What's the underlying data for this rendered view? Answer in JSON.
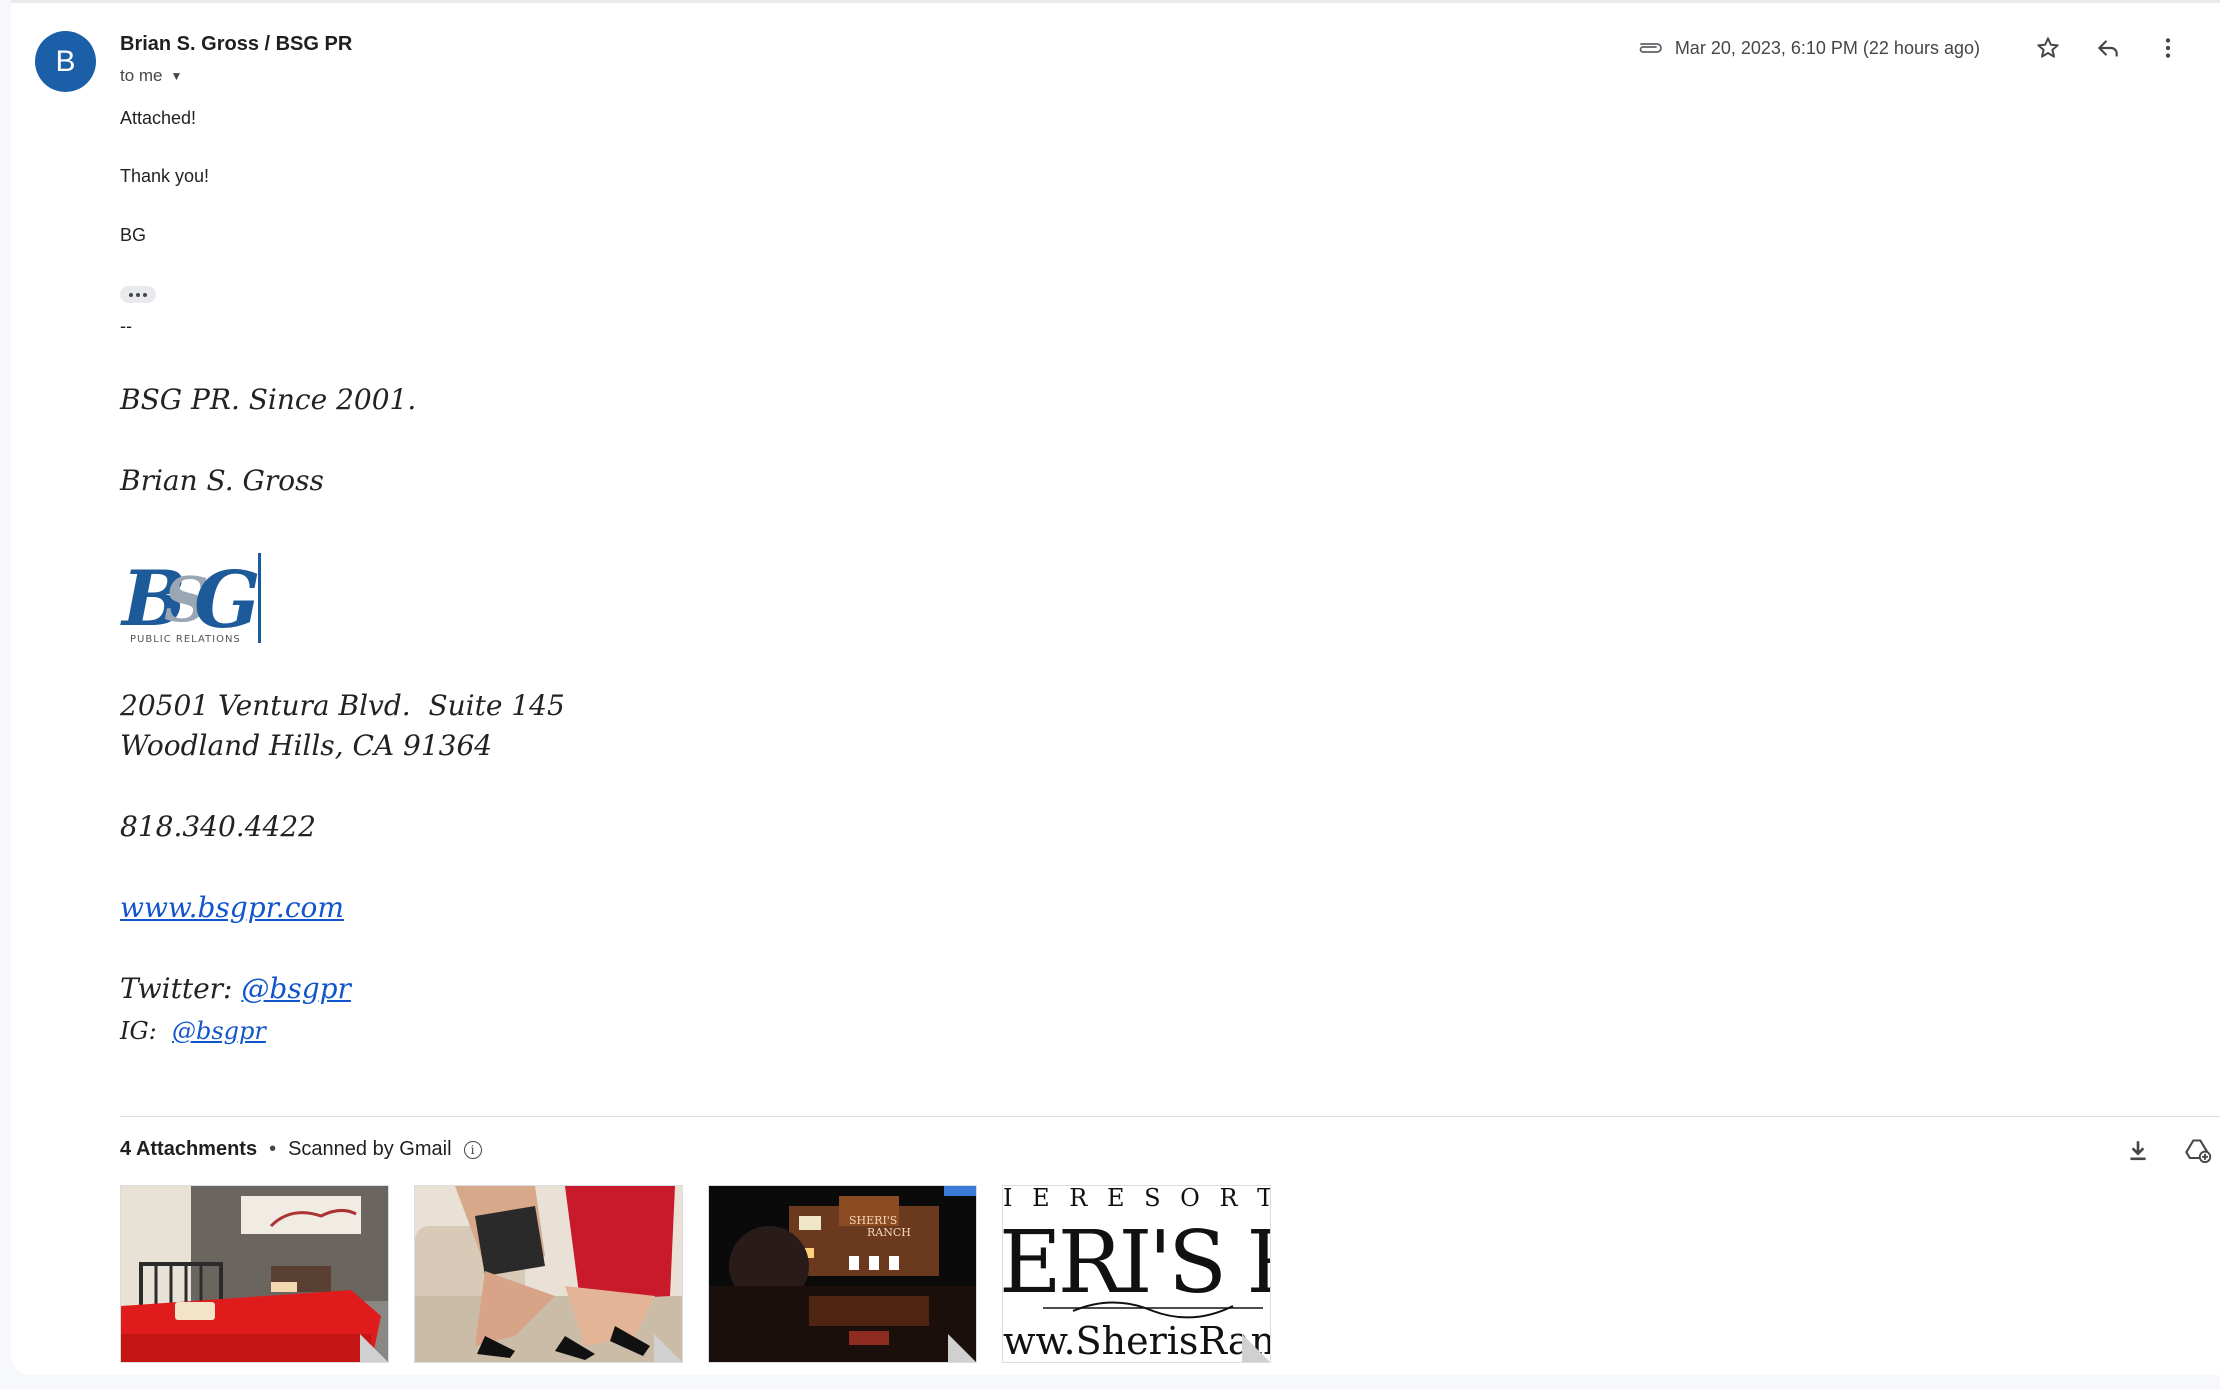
{
  "header": {
    "avatar_letter": "B",
    "sender": "Brian S. Gross / BSG PR",
    "recipient": "to me",
    "date": "Mar 20, 2023, 6:10 PM (22 hours ago)",
    "icons": [
      "attachment-icon",
      "star-icon",
      "reply-icon",
      "more-vert-icon"
    ]
  },
  "body": {
    "line1": "Attached!",
    "line2": "Thank you!",
    "line3": "BG",
    "dashes": "--"
  },
  "signature": {
    "tagline": "BSG PR. Since 2001.",
    "name": "Brian S. Gross",
    "logo_text": "BSG",
    "logo_subtext": "PUBLIC RELATIONS",
    "address1": "20501 Ventura Blvd.  Suite 145",
    "address2": "Woodland Hills, CA 91364",
    "phone": "818.340.4422",
    "website": "www.bsgpr.com",
    "twitter_label": "Twitter: ",
    "twitter_handle": "@bsgpr",
    "ig_label": "IG:  ",
    "ig_handle": "@bsgpr"
  },
  "attachments": {
    "count_label": "4 Attachments",
    "separator": "•",
    "scanned": "Scanned by Gmail",
    "thumb3_sign1": "SHERI'S",
    "thumb3_sign2": "RANCH",
    "thumb4_line1": "I E   R E S O R T",
    "thumb4_line2": "ERI'S R",
    "thumb4_line3": "ww.SherisRan"
  },
  "colors": {
    "avatar": "#1a5fa8",
    "link": "#1155cc",
    "logo_blue": "#1d5a9a"
  }
}
